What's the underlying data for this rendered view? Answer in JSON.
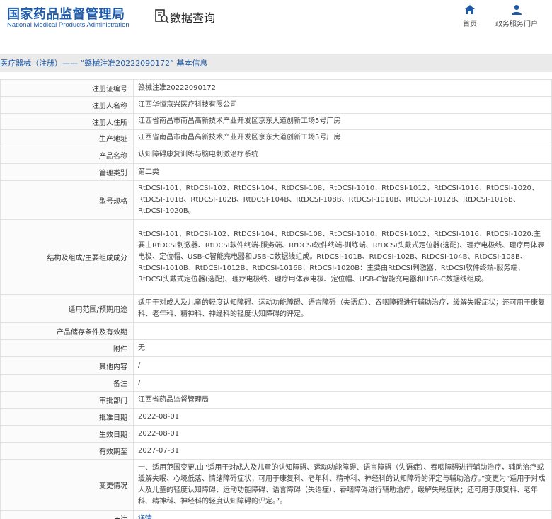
{
  "header": {
    "logo_cn": "国家药品监督管理局",
    "logo_en": "National Medical Products Administration",
    "page_name": "数据查询",
    "nav": [
      {
        "label": "首页",
        "icon": "home-icon"
      },
      {
        "label": "政务服务门户",
        "icon": "user-icon"
      }
    ]
  },
  "breadcrumb": "医疗器械（注册）—— “赣械注准20222090172” 基本信息",
  "rows": [
    {
      "key": "注册证编号",
      "value": "赣械注准20222090172"
    },
    {
      "key": "注册人名称",
      "value": "江西华恒京兴医疗科技有限公司"
    },
    {
      "key": "注册人住所",
      "value": "江西省南昌市南昌高新技术产业开发区京东大道创新工场5号厂房"
    },
    {
      "key": "生产地址",
      "value": "江西省南昌市南昌高新技术产业开发区京东大道创新工场5号厂房"
    },
    {
      "key": "产品名称",
      "value": "认知障碍康复训练与脑电刺激治疗系统"
    },
    {
      "key": "管理类别",
      "value": "第二类"
    },
    {
      "key": "型号规格",
      "value": "RtDCSI-101、RtDCSI-102、RtDCSI-104、RtDCSI-108、RtDCSI-1010、RtDCSI-1012、RtDCSI-1016、RtDCSI-1020、RtDCSI-101B、RtDCSI-102B、RtDCSI-104B、RtDCSI-108B、RtDCSI-1010B、RtDCSI-1012B、RtDCSI-1016B、RtDCSI-1020B。"
    },
    {
      "key": "结构及组成/主要组成成分",
      "value": "RtDCSI-101、RtDCSI-102、RtDCSI-104、RtDCSI-108、RtDCSI-1010、RtDCSI-1012、RtDCSI-1016、RtDCSI-1020:主要由RtDCSI刺激器、RtDCSI软件终端-服务端、RtDCSI软件终端-训练端、RtDCSI头戴式定位器(选配)、理疗电极线、理疗用体表电极、定位帽、USB-C智能充电器和USB-C数据线组成。RtDCSI-101B、RtDCSI-102B、RtDCSI-104B、RtDCSI-108B、RtDCSI-1010B、RtDCSI-1012B、RtDCSI-1016B、RtDCSI-1020B：主要由RtDCSI刺激器、RtDCSI软件终端-服务端、RtDCSI头戴式定位器(选配)、理疗电极线、理疗用体表电极、定位帽、USB-C智能充电器和USB-C数据线组成。"
    },
    {
      "key": "适用范围/预期用途",
      "value": "适用于对成人及儿童的轻度认知障碍、运动功能障碍、语言障碍（失语症）、吞咽障碍进行辅助治疗，缓解失眠症状；还可用于康复科、老年科、精神科、神经科的轻度认知障碍的评定。"
    },
    {
      "key": "产品储存条件及有效期",
      "value": ""
    },
    {
      "key": "附件",
      "value": "无"
    },
    {
      "key": "其他内容",
      "value": "/"
    },
    {
      "key": "备注",
      "value": "/"
    },
    {
      "key": "审批部门",
      "value": "江西省药品监督管理局"
    },
    {
      "key": "批准日期",
      "value": "2022-08-01"
    },
    {
      "key": "生效日期",
      "value": "2022-08-01"
    },
    {
      "key": "有效期至",
      "value": "2027-07-31"
    },
    {
      "key": "变更情况",
      "value": "一、适用范围变更,由“适用于对成人及儿童的认知障碍、运动功能障碍、语言障碍（失语症）、吞咽障碍进行辅助治疗，辅助治疗或缓解失眠、心境低落、情绪障碍症状；可用于康复科、老年科、精神科、神经科的认知障碍的评定与辅助治疗。”变更为“适用于对成人及儿童的轻度认知障碍、运动功能障碍、语言障碍（失语症）、吞咽障碍进行辅助治疗，缓解失眠症状；还可用于康复科、老年科、精神科、神经科的轻度认知障碍的评定。”。"
    }
  ],
  "note_row": {
    "key": "注",
    "value": "详情",
    "icon": "pin-icon"
  }
}
